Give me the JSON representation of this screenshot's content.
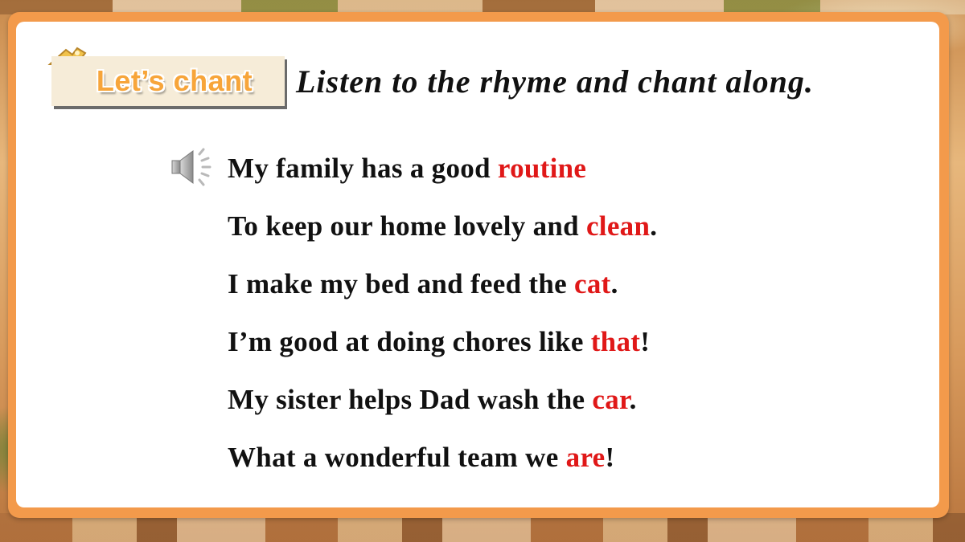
{
  "header": {
    "badge_label": "Let’s chant",
    "instruction": "Listen to the rhyme and chant along."
  },
  "icons": {
    "speaker": "speaker-icon",
    "clip": "clip-icon"
  },
  "colors": {
    "frame": "#f39a4b",
    "badge_text": "#f7a53a",
    "keyword": "#e01818",
    "text": "#111111"
  },
  "chant": {
    "lines": [
      {
        "before": "My family has a good ",
        "keyword": "routine",
        "after": ""
      },
      {
        "before": "To keep our home lovely and ",
        "keyword": "clean",
        "after": "."
      },
      {
        "before": "I make my bed and feed the ",
        "keyword": "cat",
        "after": "."
      },
      {
        "before": "I’m good at doing chores like ",
        "keyword": "that",
        "after": "!"
      },
      {
        "before": "My sister helps Dad wash the ",
        "keyword": "car",
        "after": "."
      },
      {
        "before": "What a wonderful team we ",
        "keyword": "are",
        "after": "!"
      }
    ]
  }
}
